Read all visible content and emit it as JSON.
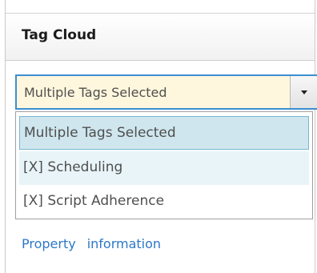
{
  "panel": {
    "title": "Tag Cloud"
  },
  "tag_select": {
    "selected_value": "Multiple Tags Selected",
    "options": [
      "Multiple Tags Selected",
      "[X] Scheduling",
      "[X] Script Adherence"
    ]
  },
  "links": {
    "property": "Property",
    "information": "information"
  },
  "colors": {
    "select_background": "#fff7dd",
    "select_border": "#3b8fd2",
    "highlighted_option": "#cfe6ee",
    "hover_option": "#e8f4f8",
    "link": "#2d77c8"
  },
  "icons": {
    "dropdown_arrow": "triangle-down"
  }
}
